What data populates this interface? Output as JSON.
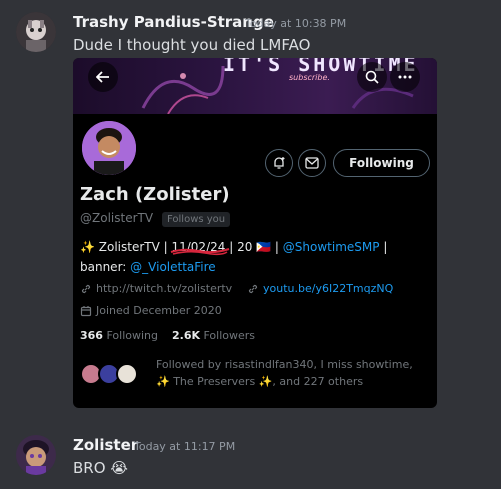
{
  "messages": [
    {
      "author": "Trashy Pandius-Strange",
      "timestamp": "Today at 10:38 PM",
      "text": "Dude I thought you died LMFAO"
    },
    {
      "author": "Zolister",
      "timestamp": "Today at 11:17 PM",
      "text": "BRO",
      "emoji": "😭"
    }
  ],
  "profile": {
    "banner_title": "IT'S SHOWTIME",
    "banner_subtitle": "subscribe.",
    "display_name": "Zach (Zolister)",
    "handle": "@ZolisterTV",
    "follows_you": "Follows you",
    "following_button": "Following",
    "bio_prefix": "✨ ZolisterTV |",
    "bio_date": "11/02/24",
    "bio_mid": "| 20 🇵🇭 |",
    "bio_link": "@ShowtimeSMP",
    "bio_end": "|",
    "banner_credit_label": "banner:",
    "banner_credit_link": "@_ViolettaFire",
    "website": "http://twitch.tv/zolistertv",
    "youtube": "youtu.be/y6I22TmqzNQ",
    "joined": "Joined December 2020",
    "following_count": "366",
    "following_label": "Following",
    "followers_count": "2.6K",
    "followers_label": "Followers",
    "followed_by": "Followed by risastindlfan340, I miss showtime, ✨ The Preservers ✨, and 227 others"
  },
  "colors": {
    "background": "#313338",
    "accent_link": "#1d9bf0",
    "strike_red": "#d7263d"
  }
}
